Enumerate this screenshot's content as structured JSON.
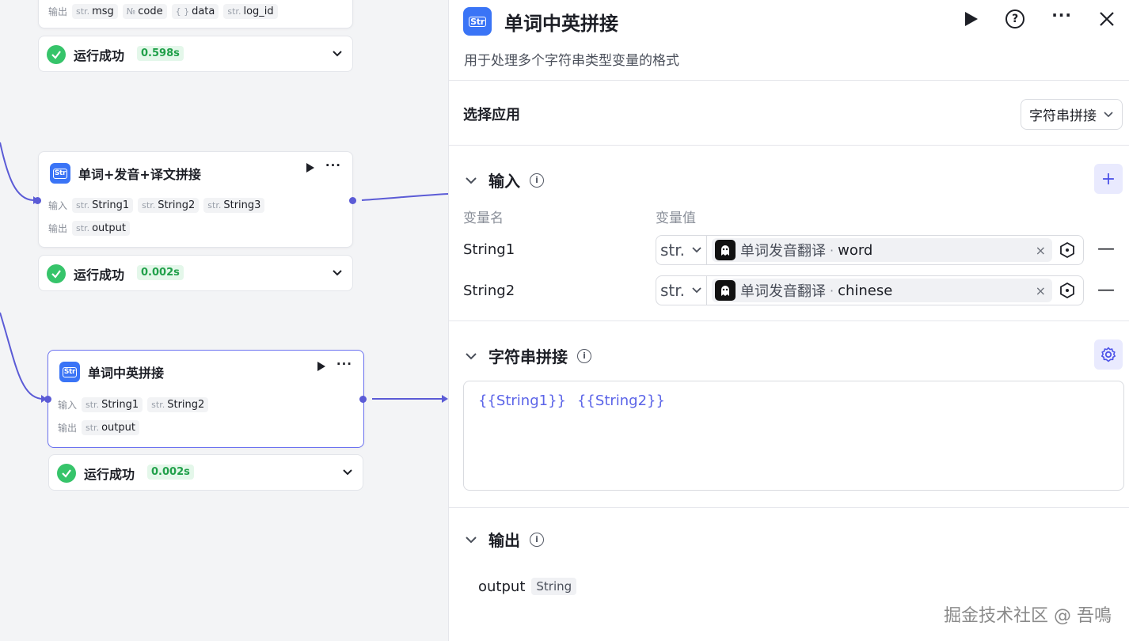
{
  "canvas": {
    "top_node": {
      "output_label": "输出",
      "outputs": [
        {
          "type": "str.",
          "name": "msg"
        },
        {
          "type": "№",
          "name": "code"
        },
        {
          "type": "{ }",
          "name": "data"
        },
        {
          "type": "str.",
          "name": "log_id"
        }
      ],
      "status": {
        "text": "运行成功",
        "time": "0.598s"
      }
    },
    "node_concat_three": {
      "title": "单词+发音+译文拼接",
      "input_label": "输入",
      "output_label": "输出",
      "inputs": [
        {
          "type": "str.",
          "name": "String1"
        },
        {
          "type": "str.",
          "name": "String2"
        },
        {
          "type": "str.",
          "name": "String3"
        }
      ],
      "outputs": [
        {
          "type": "str.",
          "name": "output"
        }
      ],
      "status": {
        "text": "运行成功",
        "time": "0.002s"
      }
    },
    "node_concat_cn_en": {
      "title": "单词中英拼接",
      "input_label": "输入",
      "output_label": "输出",
      "inputs": [
        {
          "type": "str.",
          "name": "String1"
        },
        {
          "type": "str.",
          "name": "String2"
        }
      ],
      "outputs": [
        {
          "type": "str.",
          "name": "output"
        }
      ],
      "status": {
        "text": "运行成功",
        "time": "0.002s"
      }
    }
  },
  "panel": {
    "title": "单词中英拼接",
    "description": "用于处理多个字符串类型变量的格式",
    "select_app_label": "选择应用",
    "select_app_value": "字符串拼接",
    "input_section": {
      "title": "输入",
      "col_name": "变量名",
      "col_value": "变量值",
      "rows": [
        {
          "name": "String1",
          "type": "str.",
          "source": "单词发音翻译",
          "sep": "·",
          "var": "word"
        },
        {
          "name": "String2",
          "type": "str.",
          "source": "单词发音翻译",
          "sep": "·",
          "var": "chinese"
        }
      ]
    },
    "concat_section": {
      "title": "字符串拼接",
      "template_parts": [
        "{{String1}}",
        "{{String2}}"
      ]
    },
    "output_section": {
      "title": "输出",
      "name": "output",
      "type": "String"
    }
  },
  "watermark": "掘金技术社区 @ 吾鳴",
  "colors": {
    "accent": "#4d53e8",
    "edge": "#5b5bd6",
    "node_logo": "#3a74f6",
    "success": "#36c46a"
  }
}
